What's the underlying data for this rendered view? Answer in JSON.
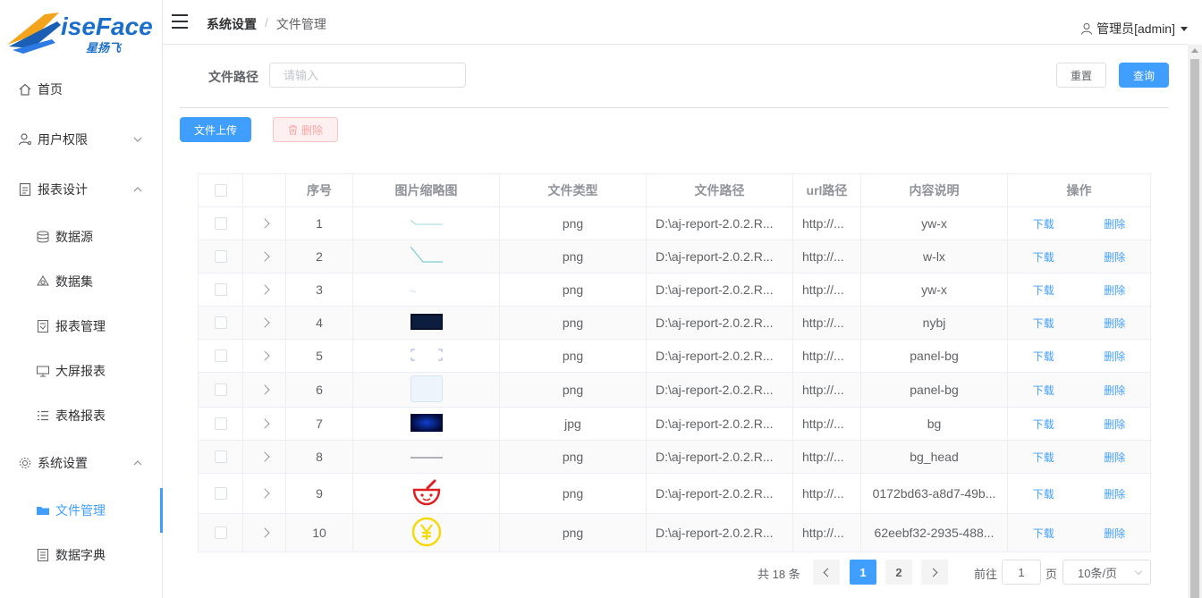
{
  "logo": {
    "brand_en": "iseFace",
    "brand_cn": "星扬飞"
  },
  "header": {
    "breadcrumb": [
      "系统设置",
      "文件管理"
    ],
    "user": "管理员[admin]"
  },
  "sidebar": {
    "items": [
      {
        "label": "首页",
        "icon": "home-icon",
        "level": "top"
      },
      {
        "label": "用户权限",
        "icon": "user-icon",
        "level": "top",
        "arrow": "down"
      },
      {
        "label": "报表设计",
        "icon": "report-icon",
        "level": "top",
        "arrow": "up"
      },
      {
        "label": "数据源",
        "icon": "database-icon",
        "level": "sub"
      },
      {
        "label": "数据集",
        "icon": "dataset-icon",
        "level": "sub"
      },
      {
        "label": "报表管理",
        "icon": "report-manage-icon",
        "level": "sub"
      },
      {
        "label": "大屏报表",
        "icon": "screen-icon",
        "level": "sub"
      },
      {
        "label": "表格报表",
        "icon": "list-icon",
        "level": "sub"
      },
      {
        "label": "系统设置",
        "icon": "settings-icon",
        "level": "top",
        "arrow": "up"
      },
      {
        "label": "文件管理",
        "icon": "folder-icon",
        "level": "sub",
        "active": true
      },
      {
        "label": "数据字典",
        "icon": "dictionary-icon",
        "level": "sub"
      }
    ]
  },
  "search": {
    "label": "文件路径",
    "placeholder": "请输入",
    "reset": "重置",
    "query": "查询"
  },
  "toolbar": {
    "upload": "文件上传",
    "delete": "删除"
  },
  "table": {
    "headers": [
      "序号",
      "图片缩略图",
      "文件类型",
      "文件路径",
      "url路径",
      "内容说明",
      "操作"
    ],
    "download_label": "下载",
    "delete_label": "删除",
    "rows": [
      {
        "no": "1",
        "type": "png",
        "path": "D:\\aj-report-2.0.2.R...",
        "url": "http://...",
        "desc": "yw-x",
        "thumb": "line"
      },
      {
        "no": "2",
        "type": "png",
        "path": "D:\\aj-report-2.0.2.R...",
        "url": "http://...",
        "desc": "w-lx",
        "thumb": "line2"
      },
      {
        "no": "3",
        "type": "png",
        "path": "D:\\aj-report-2.0.2.R...",
        "url": "http://...",
        "desc": "yw-x",
        "thumb": "line3"
      },
      {
        "no": "4",
        "type": "png",
        "path": "D:\\aj-report-2.0.2.R...",
        "url": "http://...",
        "desc": "nybj",
        "thumb": "dark"
      },
      {
        "no": "5",
        "type": "png",
        "path": "D:\\aj-report-2.0.2.R...",
        "url": "http://...",
        "desc": "panel-bg",
        "thumb": "frame"
      },
      {
        "no": "6",
        "type": "png",
        "path": "D:\\aj-report-2.0.2.R...",
        "url": "http://...",
        "desc": "panel-bg",
        "thumb": "panel"
      },
      {
        "no": "7",
        "type": "jpg",
        "path": "D:\\aj-report-2.0.2.R...",
        "url": "http://...",
        "desc": "bg",
        "thumb": "blue"
      },
      {
        "no": "8",
        "type": "png",
        "path": "D:\\aj-report-2.0.2.R...",
        "url": "http://...",
        "desc": "bg_head",
        "thumb": "head"
      },
      {
        "no": "9",
        "type": "png",
        "path": "D:\\aj-report-2.0.2.R...",
        "url": "http://...",
        "desc": "0172bd63-a8d7-49b...",
        "thumb": "mortar"
      },
      {
        "no": "10",
        "type": "png",
        "path": "D:\\aj-report-2.0.2.R...",
        "url": "http://...",
        "desc": "62eebf32-2935-488...",
        "thumb": "yen"
      }
    ]
  },
  "pagination": {
    "total": "共 18 条",
    "pages": [
      "1",
      "2"
    ],
    "current": "1",
    "goto_label": "前往",
    "goto_value": "1",
    "page_suffix": "页",
    "page_size": "10条/页"
  },
  "colors": {
    "primary": "#409eff",
    "danger_light": "#fef0f0",
    "yen": "#f5d90a",
    "mortar": "#e02020"
  }
}
